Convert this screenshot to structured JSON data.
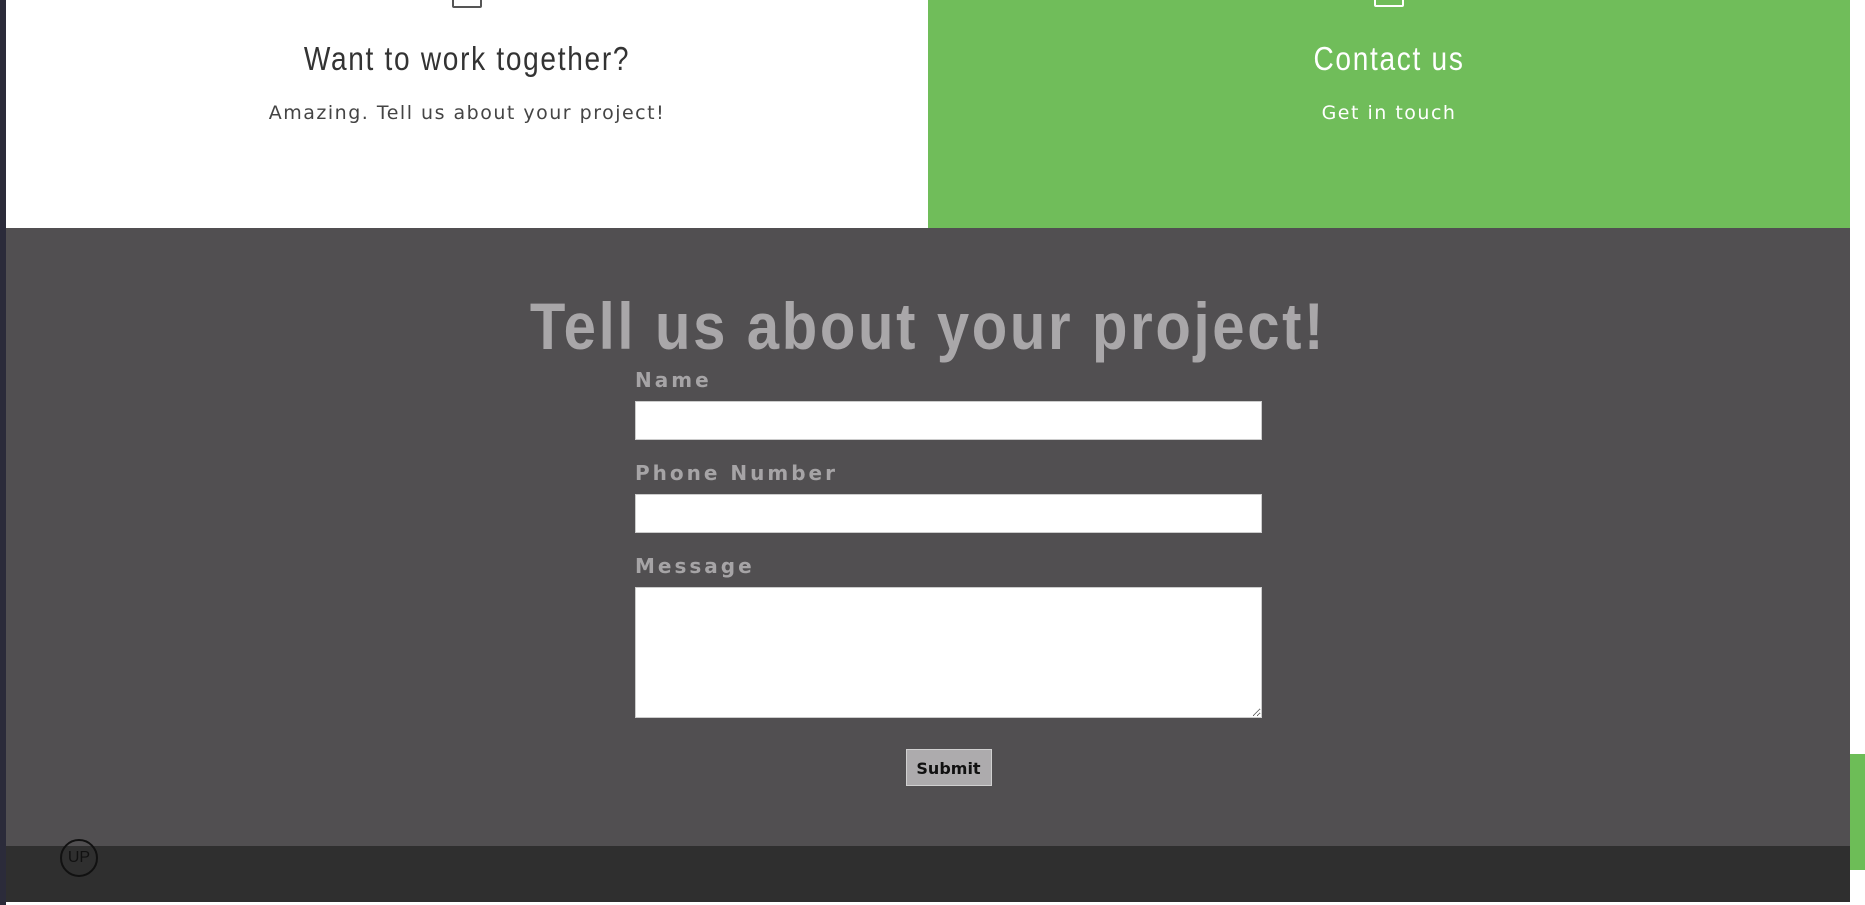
{
  "panels": {
    "work": {
      "title": "Want to work together?",
      "subtitle": "Amazing. Tell us about your project!",
      "icon": "document-icon"
    },
    "contact": {
      "title": "Contact us",
      "subtitle": "Get in touch",
      "icon": "envelope-icon"
    }
  },
  "form": {
    "heading": "Tell us about your project!",
    "fields": {
      "name_label": "Name",
      "name_value": "",
      "phone_label": "Phone Number",
      "phone_value": "",
      "message_label": "Message",
      "message_value": ""
    },
    "submit_label": "Submit"
  },
  "scroll_top": {
    "label": "UP"
  },
  "colors": {
    "accent_green": "#70bd5a",
    "form_background": "#514f51",
    "footer_background": "#2f2f2f",
    "heading_text": "#a9a7a9"
  }
}
